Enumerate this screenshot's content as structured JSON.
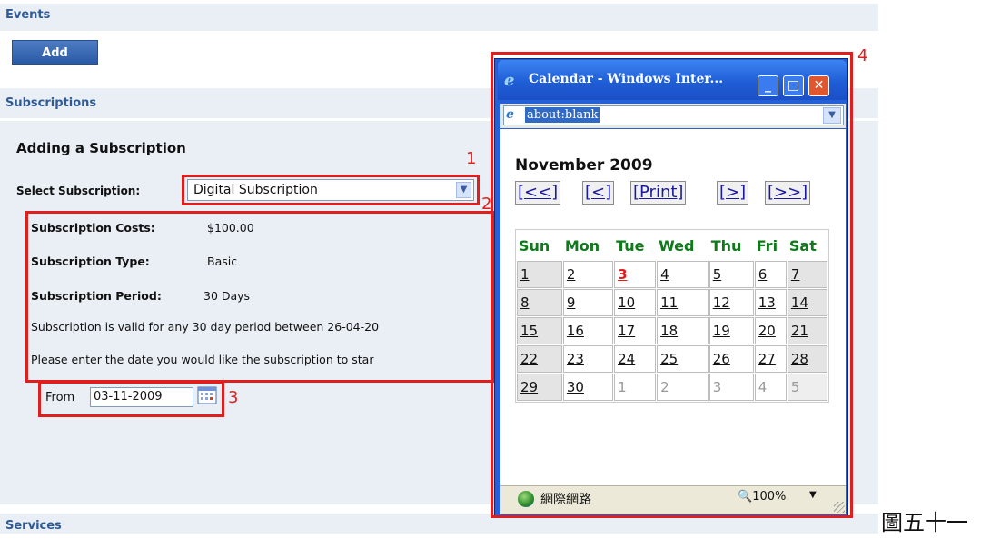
{
  "sections": {
    "events": "Events",
    "add_label": "Add",
    "subscriptions": "Subscriptions",
    "services": "Services"
  },
  "form": {
    "title": "Adding a Subscription",
    "select_label": "Select Subscription:",
    "select_value": "Digital Subscription",
    "costs_label": "Subscription Costs:",
    "costs_value": "$100.00",
    "type_label": "Subscription Type:",
    "type_value": "Basic",
    "period_label": "Subscription Period:",
    "period_value": "30 Days",
    "valid_text": "Subscription is valid for any 30 day period between 26-04-20",
    "enter_text": "Please enter the date you would like the subscription to star",
    "from_label": "From",
    "from_value": "03-11-2009"
  },
  "annotations": {
    "n1": "1",
    "n2": "2",
    "n3": "3",
    "n4": "4",
    "colors": {
      "highlight": "#e01e1e"
    }
  },
  "popup": {
    "title": "Calendar - Windows Inter...",
    "address": "about:blank",
    "month": "November 2009",
    "nav": [
      "[<<]",
      "[<]",
      "[Print]",
      "[>]",
      "[>>]"
    ],
    "weekdays": [
      "Sun",
      "Mon",
      "Tue",
      "Wed",
      "Thu",
      "Fri",
      "Sat"
    ],
    "weeks": [
      [
        "1",
        "2",
        "3",
        "4",
        "5",
        "6",
        "7"
      ],
      [
        "8",
        "9",
        "10",
        "11",
        "12",
        "13",
        "14"
      ],
      [
        "15",
        "16",
        "17",
        "18",
        "19",
        "20",
        "21"
      ],
      [
        "22",
        "23",
        "24",
        "25",
        "26",
        "27",
        "28"
      ],
      [
        "29",
        "30",
        "1",
        "2",
        "3",
        "4",
        "5"
      ]
    ],
    "today": "3",
    "status_zone": "網際網路",
    "zoom": "100%",
    "colors": {
      "weekday_header": "#0e7a1a",
      "today": "#e01e1e",
      "titlebar": "#2460d8"
    }
  },
  "caption": "圖五十一"
}
